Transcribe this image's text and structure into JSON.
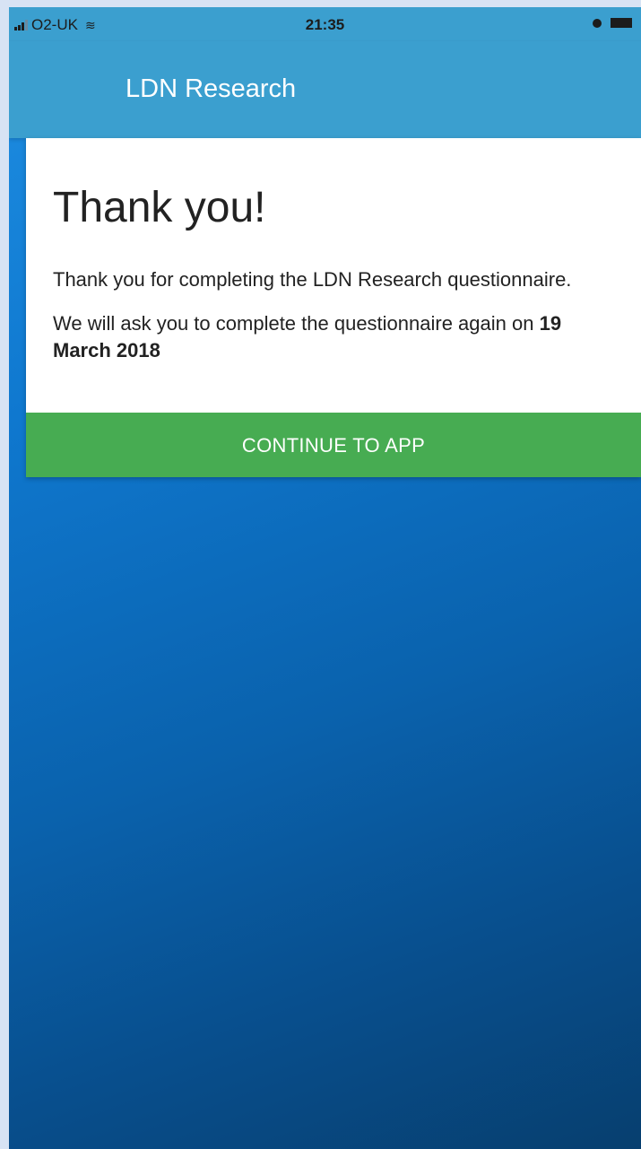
{
  "status_bar": {
    "carrier": "O2-UK",
    "time": "21:35",
    "icons": [
      "signal-icon",
      "wifi-icon",
      "alarm-icon",
      "battery-icon"
    ]
  },
  "header": {
    "title": "LDN Research"
  },
  "card": {
    "heading": "Thank you!",
    "paragraph1": "Thank you for completing the LDN Research questionnaire.",
    "paragraph2_prefix": "We will ask you to complete the questionnaire again on",
    "date": "19 March 2018",
    "button_label": "CONTINUE TO APP"
  },
  "colors": {
    "header_bg": "#3b9fcf",
    "button_bg": "#47ac52",
    "background_gradient_start": "#1f8fe3",
    "background_gradient_end": "#073f6f"
  }
}
